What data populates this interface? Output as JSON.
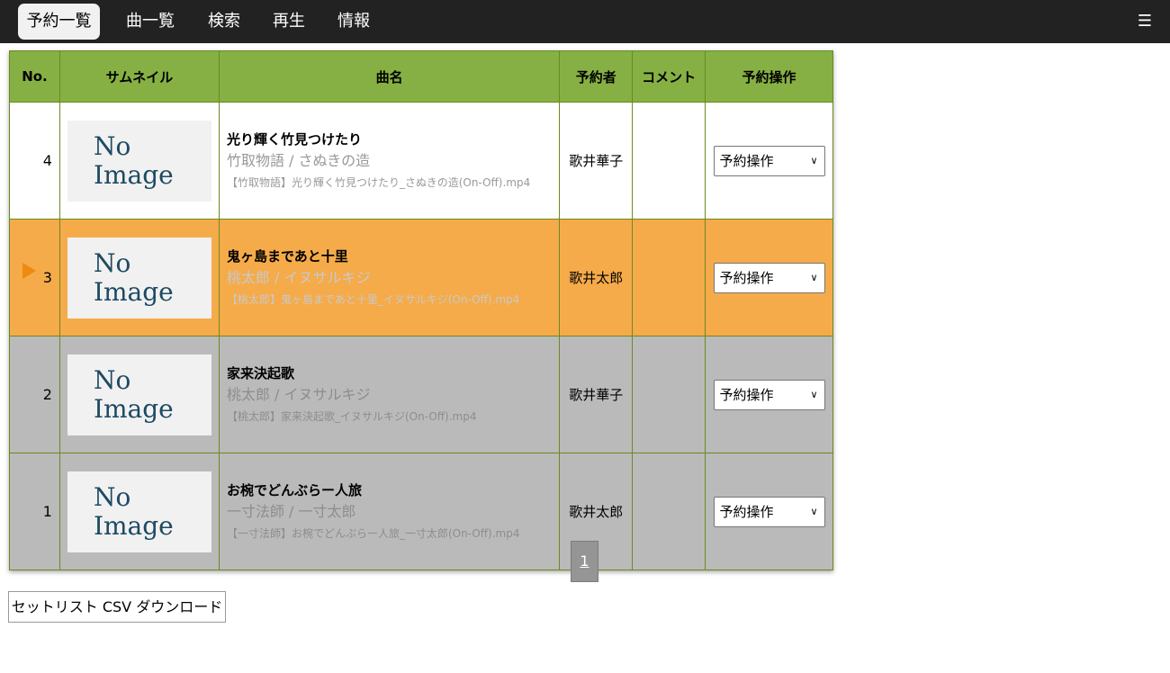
{
  "nav": {
    "items": [
      "予約一覧",
      "曲一覧",
      "検索",
      "再生",
      "情報"
    ],
    "menu_icon": "☰"
  },
  "table": {
    "headers": [
      "No.",
      "サムネイル",
      "曲名",
      "予約者",
      "コメント",
      "予約操作"
    ],
    "rows": [
      {
        "no": "4",
        "thumb_line1": "No",
        "thumb_line2": "Image",
        "title": "光り輝く竹見つけたり",
        "sub": "竹取物語 / さぬきの造",
        "file": "【竹取物語】光り輝く竹見つけたり_さぬきの造(On-Off).mp4",
        "singer": "歌井華子",
        "comment": "",
        "op": "予約操作",
        "state": "normal"
      },
      {
        "no": "3",
        "thumb_line1": "No",
        "thumb_line2": "Image",
        "title": "鬼ヶ島まであと十里",
        "sub": "桃太郎 / イヌサルキジ",
        "file": "【桃太郎】鬼ヶ島まであと十里_イヌサルキジ(On-Off).mp4",
        "singer": "歌井太郎",
        "comment": "",
        "op": "予約操作",
        "state": "playing"
      },
      {
        "no": "2",
        "thumb_line1": "No",
        "thumb_line2": "Image",
        "title": "家来決起歌",
        "sub": "桃太郎 / イヌサルキジ",
        "file": "【桃太郎】家来決起歌_イヌサルキジ(On-Off).mp4",
        "singer": "歌井華子",
        "comment": "",
        "op": "予約操作",
        "state": "played"
      },
      {
        "no": "1",
        "thumb_line1": "No",
        "thumb_line2": "Image",
        "title": "お椀でどんぶらー人旅",
        "sub": "一寸法師 / 一寸太郎",
        "file": "【一寸法師】お椀でどんぶらー人旅_一寸太郎(On-Off).mp4",
        "singer": "歌井太郎",
        "comment": "",
        "op": "予約操作",
        "state": "played"
      }
    ]
  },
  "pager": {
    "current": "1"
  },
  "csv_button": "セットリスト CSV ダウンロード",
  "colors": {
    "header_green": "#86b043",
    "playing_orange": "#f5ab4a",
    "played_gray": "#bababa",
    "play_icon": "#ef8a10"
  }
}
